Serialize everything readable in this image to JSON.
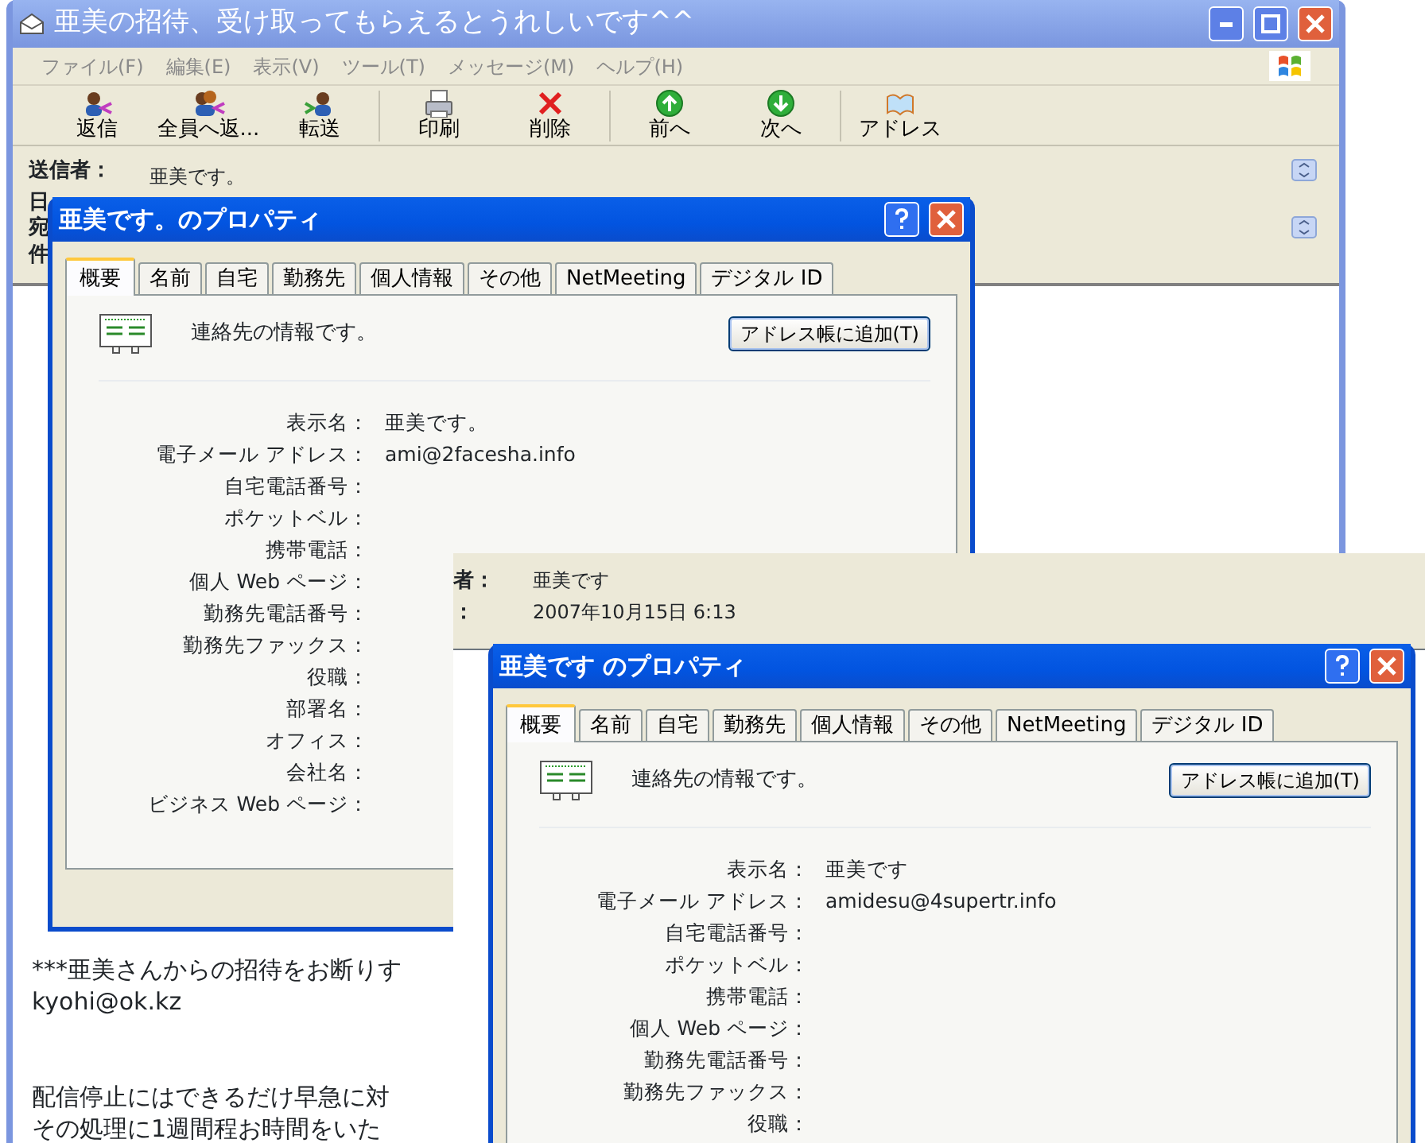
{
  "main_window": {
    "title": "亜美の招待、受け取ってもらえるとうれしいです^^",
    "menu": [
      "ファイル(F)",
      "編集(E)",
      "表示(V)",
      "ツール(T)",
      "メッセージ(M)",
      "ヘルプ(H)"
    ],
    "toolbar": [
      {
        "label": "返信",
        "kind": "reply"
      },
      {
        "label": "全員へ返...",
        "kind": "reply-all"
      },
      {
        "label": "転送",
        "kind": "forward"
      },
      {
        "label": "印刷",
        "kind": "print"
      },
      {
        "label": "削除",
        "kind": "delete"
      },
      {
        "label": "前へ",
        "kind": "previous"
      },
      {
        "label": "次へ",
        "kind": "next"
      },
      {
        "label": "アドレス",
        "kind": "address"
      }
    ],
    "header": {
      "from_label": "送信者：",
      "from_value": "亜美です。",
      "other_labels": [
        "日",
        "宛",
        "件"
      ]
    },
    "body_paragraphs": [
      [
        "***亜美さんからの招待をお断りす",
        "kyohi@ok.kz"
      ],
      [
        "配信停止にはできるだけ早急に対",
        "その処理に1週間程お時間をいた"
      ]
    ]
  },
  "dialog_1": {
    "title": "亜美です。のプロパティ",
    "tabs": [
      {
        "label": "概要",
        "selected": true
      },
      {
        "label": "名前",
        "selected": false
      },
      {
        "label": "自宅",
        "selected": false
      },
      {
        "label": "勤務先",
        "selected": false
      },
      {
        "label": "個人情報",
        "selected": false
      },
      {
        "label": "その他",
        "selected": false
      },
      {
        "label": "NetMeeting",
        "selected": false
      },
      {
        "label": "デジタル ID",
        "selected": false
      }
    ],
    "info": "連絡先の情報です。",
    "add_button": "アドレス帳に追加(T)",
    "fields": [
      {
        "label": "表示名：",
        "value": "亜美です。"
      },
      {
        "label": "電子メール アドレス：",
        "value": "ami@2facesha.info"
      },
      {
        "label": "自宅電話番号："
      },
      {
        "label": "ポケットベル："
      },
      {
        "label": "携帯電話："
      },
      {
        "label": "個人 Web ページ："
      },
      {
        "label": "勤務先電話番号："
      },
      {
        "label": "勤務先ファックス："
      },
      {
        "label": "役職："
      },
      {
        "label": "部署名："
      },
      {
        "label": "オフィス："
      },
      {
        "label": "会社名："
      },
      {
        "label": "ビジネス Web ページ："
      }
    ]
  },
  "second_window": {
    "header": [
      {
        "label": "者：",
        "value": "亜美です"
      },
      {
        "label": "：",
        "value": "2007年10月15日 6:13"
      }
    ]
  },
  "dialog_2": {
    "title": "亜美です のプロパティ",
    "tabs": [
      {
        "label": "概要",
        "selected": true
      },
      {
        "label": "名前",
        "selected": false
      },
      {
        "label": "自宅",
        "selected": false
      },
      {
        "label": "勤務先",
        "selected": false
      },
      {
        "label": "個人情報",
        "selected": false
      },
      {
        "label": "その他",
        "selected": false
      },
      {
        "label": "NetMeeting",
        "selected": false
      },
      {
        "label": "デジタル ID",
        "selected": false
      }
    ],
    "info": "連絡先の情報です。",
    "add_button": "アドレス帳に追加(T)",
    "fields": [
      {
        "label": "表示名：",
        "value": "亜美です"
      },
      {
        "label": "電子メール アドレス：",
        "value": "amidesu@4supertr.info"
      },
      {
        "label": "自宅電話番号："
      },
      {
        "label": "ポケットベル："
      },
      {
        "label": "携帯電話："
      },
      {
        "label": "個人 Web ページ："
      },
      {
        "label": "勤務先電話番号："
      },
      {
        "label": "勤務先ファックス："
      },
      {
        "label": "役職："
      }
    ]
  }
}
